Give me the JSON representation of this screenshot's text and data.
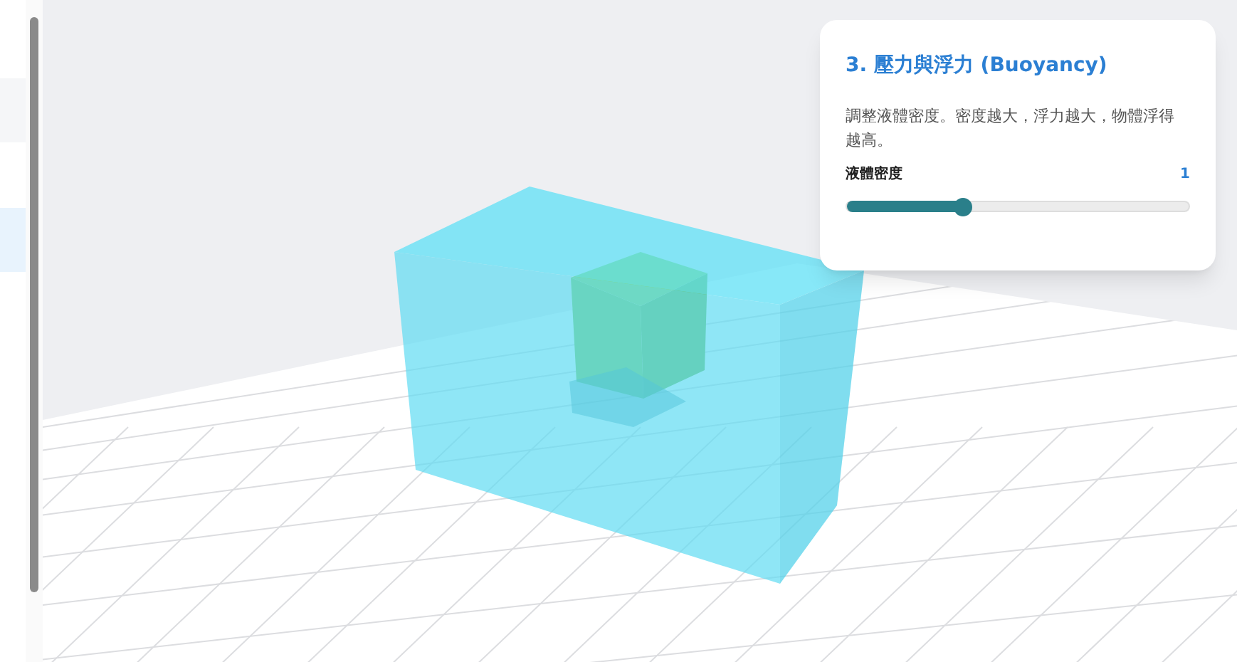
{
  "panel": {
    "title": "3. 壓力與浮力 (Buoyancy)",
    "description": "調整液體密度。密度越大，浮力越大，物體浮得越高。",
    "slider": {
      "label": "液體密度",
      "reading": "1",
      "level": 0.34
    }
  }
}
